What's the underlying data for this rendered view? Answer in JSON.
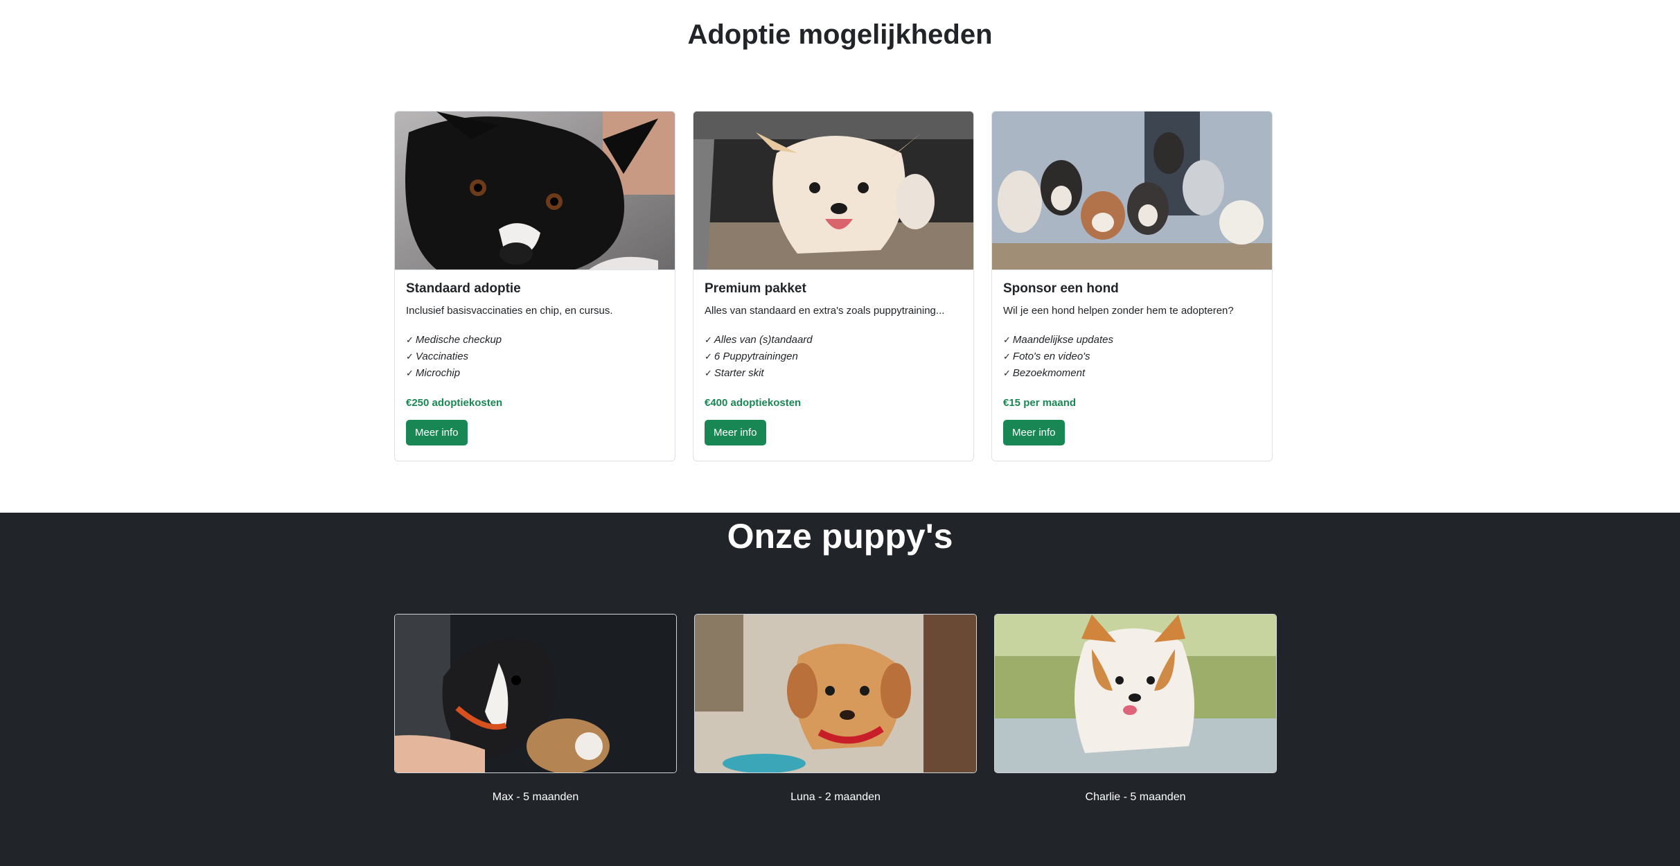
{
  "adoption": {
    "title": "Adoptie mogelijkheden",
    "cards": [
      {
        "title": "Standaard adoptie",
        "text": "Inclusief basisvaccinaties en chip, en cursus.",
        "features": [
          "Medische checkup",
          "Vaccinaties",
          "Microchip"
        ],
        "price": "€250 adoptiekosten",
        "button": "Meer info"
      },
      {
        "title": "Premium pakket",
        "text": "Alles van standaard en extra's zoals puppytraining...",
        "features": [
          "Alles van (s)tandaard",
          "6 Puppytrainingen",
          "Starter skit"
        ],
        "price": "€400 adoptiekosten",
        "button": "Meer info"
      },
      {
        "title": "Sponsor een hond",
        "text": "Wil je een hond helpen zonder hem te adopteren?",
        "features": [
          "Maandelijkse updates",
          "Foto's en video's",
          "Bezoekmoment"
        ],
        "price": "€15 per maand",
        "button": "Meer info"
      }
    ]
  },
  "puppies": {
    "title": "Onze puppy's",
    "items": [
      {
        "caption": "Max - 5 maanden"
      },
      {
        "caption": "Luna - 2 maanden"
      },
      {
        "caption": "Charlie - 5 maanden"
      }
    ]
  },
  "colors": {
    "accent": "#198754",
    "dark_bg": "#212529"
  }
}
